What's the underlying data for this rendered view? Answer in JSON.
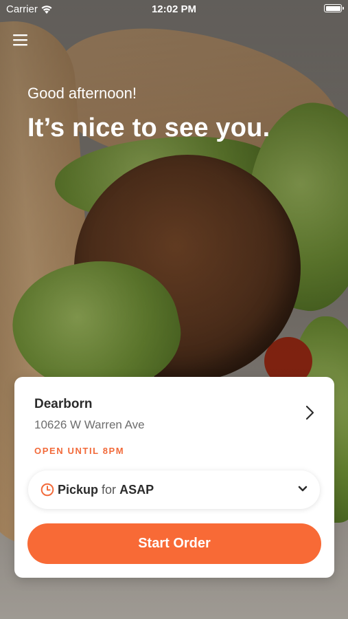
{
  "status_bar": {
    "carrier": "Carrier",
    "time": "12:02 PM",
    "battery_level": 1.0
  },
  "header": {
    "menu_icon": "hamburger-menu-icon",
    "greeting": "Good afternoon!",
    "headline": "It’s nice to see you."
  },
  "store": {
    "name": "Dearborn",
    "address": "10626 W Warren Ave",
    "hours_status": "OPEN UNTIL 8PM",
    "chevron_icon": "chevron-right-icon"
  },
  "order_options": {
    "icon": "clock-icon",
    "method": "Pickup",
    "connector": "for",
    "time": "ASAP",
    "dropdown_icon": "chevron-down-icon"
  },
  "actions": {
    "start_order_label": "Start Order"
  },
  "colors": {
    "accent": "#f86a36",
    "hours_status": "#f26a3a",
    "card_background": "#ffffff",
    "text_primary": "#2b2b2b",
    "text_secondary": "#6d6d6d"
  },
  "background_image": "falafel-pita-wrap-photo"
}
